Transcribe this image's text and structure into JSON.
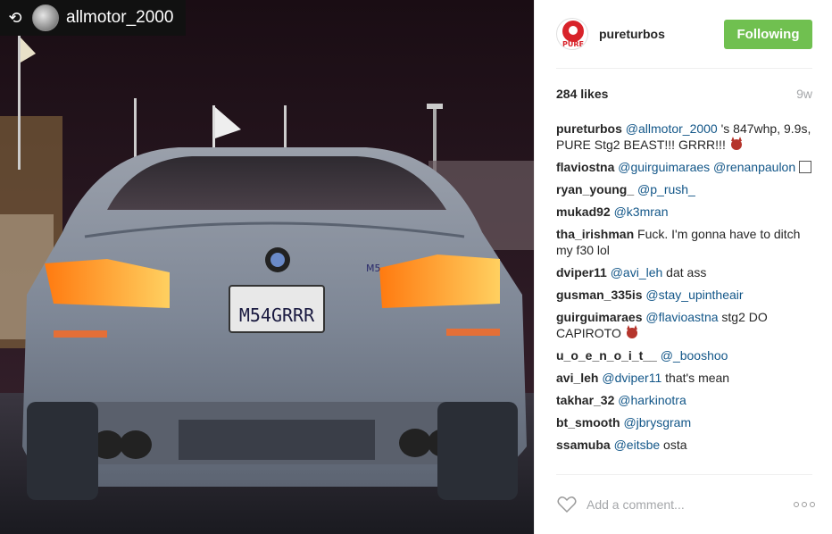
{
  "photo": {
    "repost_user": "allmotor_2000",
    "plate_text": "M54GRRR",
    "badge_text": "M5"
  },
  "post": {
    "username": "pureturbos",
    "avatar_text": "PURE",
    "follow_label": "Following",
    "likes": "284 likes",
    "age": "9w"
  },
  "comments": [
    {
      "user": "pureturbos",
      "mention": "@allmotor_2000",
      "text": " 's 847whp, 9.9s, PURE Stg2 BEAST!!! GRRR!!! ",
      "emoji": "devil"
    },
    {
      "user": "flaviostna",
      "mention": "@guirguimaraes @renanpaulon",
      "text": " ",
      "emoji": "box"
    },
    {
      "user": "ryan_young_",
      "mention": "@p_rush_",
      "text": ""
    },
    {
      "user": "mukad92",
      "mention": "@k3mran",
      "text": ""
    },
    {
      "user": "tha_irishman",
      "mention": "",
      "text": "Fuck. I'm gonna have to ditch my f30 lol"
    },
    {
      "user": "dviper11",
      "mention": "@avi_leh",
      "text": " dat ass"
    },
    {
      "user": "gusman_335is",
      "mention": "@stay_upintheair",
      "text": ""
    },
    {
      "user": "guirguimaraes",
      "mention": "@flavioastna",
      "text": " stg2 DO CAPIROTO ",
      "emoji": "devil"
    },
    {
      "user": "u_o_e_n_o_i_t__",
      "mention": "@_booshoo",
      "text": ""
    },
    {
      "user": "avi_leh",
      "mention": "@dviper11",
      "text": " that's mean"
    },
    {
      "user": "takhar_32",
      "mention": "@harkinotra",
      "text": ""
    },
    {
      "user": "bt_smooth",
      "mention": "@jbrysgram",
      "text": ""
    },
    {
      "user": "ssamuba",
      "mention": "@eitsbe",
      "text": " osta"
    }
  ],
  "add_comment": {
    "placeholder": "Add a comment..."
  },
  "colors": {
    "follow_green": "#70c050",
    "mention_blue": "#125688",
    "brand_red": "#d8232a"
  },
  "icons": {
    "repost": "repost-icon",
    "like": "heart-icon",
    "more": "more-options-icon"
  }
}
